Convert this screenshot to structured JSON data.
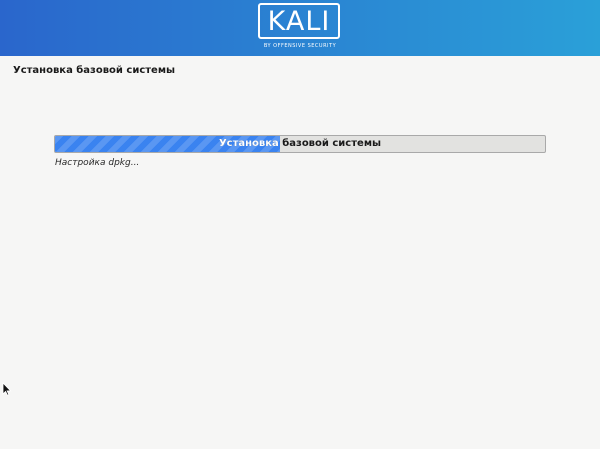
{
  "header": {
    "logo_text": "KALI",
    "logo_subtitle": "BY OFFENSIVE SECURITY",
    "gradient_colors": [
      "#2a66cc",
      "#2aa0d8"
    ]
  },
  "page": {
    "title": "Установка базовой системы"
  },
  "progress": {
    "label": "Установка базовой системы",
    "fraction": 0.46,
    "fill_color": "#3a83f0",
    "track_color": "#e2e2e0"
  },
  "status": {
    "text": "Настройка dpkg..."
  },
  "pointer": {
    "icon": "mouse-pointer-icon"
  }
}
